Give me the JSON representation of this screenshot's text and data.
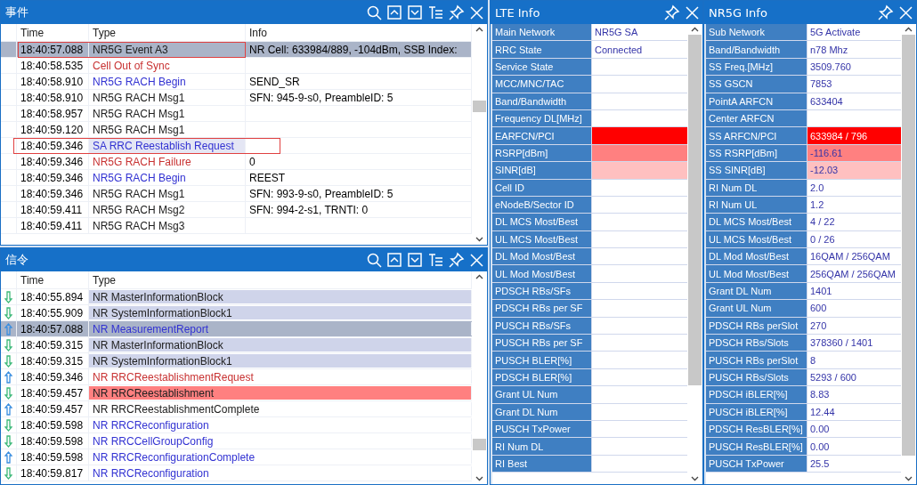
{
  "events_panel": {
    "title": "事件",
    "columns": [
      "Time",
      "Type",
      "Info"
    ],
    "rows": [
      {
        "time": "18:40:57.088",
        "type": "NR5G Event A3",
        "info": "NR Cell: 633984/889, -104dBm, SSB Index:",
        "kind": "plain",
        "selected": true,
        "annotated": true,
        "type_highlight": false
      },
      {
        "time": "18:40:58.535",
        "type": "Cell Out of Sync",
        "kind": "error",
        "selected": false,
        "annotated": false,
        "type_highlight": false
      },
      {
        "time": "18:40:58.910",
        "type": "NR5G RACH Begin",
        "info": "SEND_SR",
        "kind": "notice",
        "selected": false,
        "annotated": false,
        "type_highlight": false
      },
      {
        "time": "18:40:58.910",
        "type": "NR5G RACH Msg1",
        "info": "SFN: 945-9-s0, PreambleID: 5",
        "kind": "plain",
        "selected": false,
        "annotated": false,
        "type_highlight": false
      },
      {
        "time": "18:40:58.957",
        "type": "NR5G RACH Msg1",
        "kind": "plain",
        "selected": false,
        "annotated": false,
        "type_highlight": false
      },
      {
        "time": "18:40:59.120",
        "type": "NR5G RACH Msg1",
        "kind": "plain",
        "selected": false,
        "annotated": false,
        "type_highlight": false
      },
      {
        "time": "18:40:59.346",
        "type": "SA RRC Reestablish Request",
        "kind": "notice",
        "selected": false,
        "annotated": true,
        "type_highlight": true
      },
      {
        "time": "18:40:59.346",
        "type": "NR5G RACH Failure",
        "info": "0",
        "kind": "error",
        "selected": false,
        "annotated": false,
        "type_highlight": false
      },
      {
        "time": "18:40:59.346",
        "type": "NR5G RACH Begin",
        "info": "REEST",
        "kind": "notice",
        "selected": false,
        "annotated": false,
        "type_highlight": false
      },
      {
        "time": "18:40:59.346",
        "type": "NR5G RACH Msg1",
        "info": "SFN: 993-9-s0, PreambleID: 5",
        "kind": "plain",
        "selected": false,
        "annotated": false,
        "type_highlight": false
      },
      {
        "time": "18:40:59.411",
        "type": "NR5G RACH Msg2",
        "info": "SFN: 994-2-s1, TRNTI: 0",
        "kind": "plain",
        "selected": false,
        "annotated": false,
        "type_highlight": false
      },
      {
        "time": "18:40:59.411",
        "type": "NR5G RACH Msg3",
        "kind": "plain",
        "selected": false,
        "annotated": false,
        "type_highlight": false
      }
    ]
  },
  "signaling_panel": {
    "title": "信令",
    "columns": [
      "Time",
      "Type"
    ],
    "rows": [
      {
        "uplink": false,
        "time": "18:40:55.894",
        "type": "NR MasterInformationBlock",
        "kind": "plain",
        "shaded": true,
        "alert": false,
        "selected": false
      },
      {
        "uplink": false,
        "time": "18:40:55.909",
        "type": "NR SystemInformationBlock1",
        "kind": "plain",
        "shaded": true,
        "alert": false,
        "selected": false
      },
      {
        "uplink": true,
        "time": "18:40:57.088",
        "type": "NR MeasurementReport",
        "kind": "notice",
        "shaded": false,
        "alert": false,
        "selected": true
      },
      {
        "uplink": false,
        "time": "18:40:59.315",
        "type": "NR MasterInformationBlock",
        "kind": "plain",
        "shaded": true,
        "alert": false,
        "selected": false
      },
      {
        "uplink": false,
        "time": "18:40:59.315",
        "type": "NR SystemInformationBlock1",
        "kind": "plain",
        "shaded": true,
        "alert": false,
        "selected": false
      },
      {
        "uplink": true,
        "time": "18:40:59.346",
        "type": "NR RRCReestablishmentRequest",
        "kind": "error",
        "shaded": false,
        "alert": false,
        "selected": false
      },
      {
        "uplink": false,
        "time": "18:40:59.457",
        "type": "NR RRCReestablishment",
        "kind": "plain",
        "shaded": false,
        "alert": true,
        "selected": false
      },
      {
        "uplink": true,
        "time": "18:40:59.457",
        "type": "NR RRCReestablishmentComplete",
        "kind": "plain",
        "shaded": false,
        "alert": false,
        "selected": false
      },
      {
        "uplink": false,
        "time": "18:40:59.598",
        "type": "NR RRCReconfiguration",
        "kind": "notice",
        "shaded": false,
        "alert": false,
        "selected": false
      },
      {
        "uplink": false,
        "time": "18:40:59.598",
        "type": "NR RRCCellGroupConfig",
        "kind": "notice",
        "shaded": false,
        "alert": false,
        "selected": false
      },
      {
        "uplink": true,
        "time": "18:40:59.598",
        "type": "NR RRCReconfigurationComplete",
        "kind": "notice",
        "shaded": false,
        "alert": false,
        "selected": false
      },
      {
        "uplink": false,
        "time": "18:40:59.817",
        "type": "NR RRCReconfiguration",
        "kind": "notice",
        "shaded": false,
        "alert": false,
        "selected": false
      }
    ]
  },
  "lte_info": {
    "title": "LTE Info",
    "rows": [
      {
        "label": "Main Network",
        "value": "NR5G   SA"
      },
      {
        "label": "RRC State",
        "value": "Connected"
      },
      {
        "label": "Service State"
      },
      {
        "label": "MCC/MNC/TAC"
      },
      {
        "label": "Band/Bandwidth"
      },
      {
        "label": "Frequency DL[MHz]"
      },
      {
        "label": "EARFCN/PCI",
        "color": "#ff0000"
      },
      {
        "label": "RSRP[dBm]",
        "color": "#ff8080"
      },
      {
        "label": "SINR[dB]",
        "color": "#ffc0c0"
      },
      {
        "label": "Cell ID"
      },
      {
        "label": "eNodeB/Sector ID"
      },
      {
        "label": "DL MCS Most/Best"
      },
      {
        "label": "UL MCS Most/Best"
      },
      {
        "label": "DL Mod Most/Best"
      },
      {
        "label": "UL Mod Most/Best"
      },
      {
        "label": "PDSCH RBs/SFs"
      },
      {
        "label": "PDSCH RBs per SF"
      },
      {
        "label": "PUSCH RBs/SFs"
      },
      {
        "label": "PUSCH RBs per SF"
      },
      {
        "label": "PUSCH BLER[%]"
      },
      {
        "label": "PDSCH BLER[%]"
      },
      {
        "label": "Grant UL Num"
      },
      {
        "label": "Grant DL Num"
      },
      {
        "label": "PUSCH TxPower"
      },
      {
        "label": "RI Num DL"
      },
      {
        "label": "RI Best"
      }
    ]
  },
  "nr5g_info": {
    "title": "NR5G Info",
    "rows": [
      {
        "label": "Sub Network",
        "value": "5G Activate"
      },
      {
        "label": "Band/Bandwidth",
        "value": "n78   Mhz"
      },
      {
        "label": "SS Freq.[MHz]",
        "value": "3509.760"
      },
      {
        "label": "SS GSCN",
        "value": "7853"
      },
      {
        "label": "PointA ARFCN",
        "value": "633404"
      },
      {
        "label": "Center ARFCN"
      },
      {
        "label": "SS ARFCN/PCI",
        "value": "633984 / 796",
        "color": "#ff0000"
      },
      {
        "label": "SS RSRP[dBm]",
        "value": "-116.61",
        "color": "#ff8080"
      },
      {
        "label": "SS SINR[dB]",
        "value": "-12.03",
        "color": "#ffc0c0"
      },
      {
        "label": "RI Num DL",
        "value": "2.0"
      },
      {
        "label": "RI Num UL",
        "value": "1.2"
      },
      {
        "label": "DL MCS Most/Best",
        "value": "4 / 22"
      },
      {
        "label": "UL MCS Most/Best",
        "value": "0 / 26"
      },
      {
        "label": "DL Mod Most/Best",
        "value": "16QAM / 256QAM"
      },
      {
        "label": "UL Mod Most/Best",
        "value": "256QAM / 256QAM"
      },
      {
        "label": "Grant DL Num",
        "value": "1401"
      },
      {
        "label": "Grant UL Num",
        "value": "600"
      },
      {
        "label": "PDSCH RBs perSlot",
        "value": "270"
      },
      {
        "label": "PDSCH RBs/Slots",
        "value": "378360 / 1401"
      },
      {
        "label": "PUSCH RBs perSlot",
        "value": "8"
      },
      {
        "label": "PUSCH RBs/Slots",
        "value": "5293 /  600"
      },
      {
        "label": "PDSCH iBLER[%]",
        "value": "8.83"
      },
      {
        "label": "PUSCH iBLER[%]",
        "value": "12.44"
      },
      {
        "label": "PDSCH ResBLER[%]",
        "value": "0.00"
      },
      {
        "label": "PUSCH ResBLER[%]",
        "value": "0.00"
      },
      {
        "label": "PUSCH TxPower",
        "value": "25.5"
      }
    ]
  }
}
